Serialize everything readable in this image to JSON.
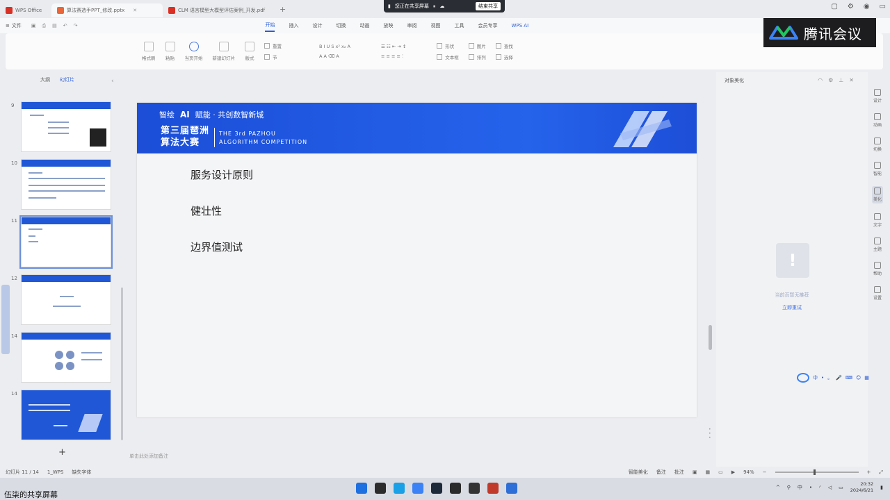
{
  "titlebar": {
    "tabs": [
      {
        "label": "WPS Office",
        "color": "#d93025"
      },
      {
        "label": "算法赛选手PPT_修改.pptx",
        "color": "#e8663a"
      },
      {
        "label": "CLM 语言模型大模型评估案例_开发.pdf",
        "color": "#d93025"
      }
    ],
    "new_tab": "+",
    "share_banner": {
      "label": "您正在共享屏幕",
      "stop": "结束共享"
    }
  },
  "menubar": {
    "file": "文件",
    "items": [
      "开始",
      "插入",
      "设计",
      "切换",
      "动画",
      "放映",
      "审阅",
      "视图",
      "工具",
      "会员专享"
    ],
    "active": "开始",
    "wps_ai": "WPS AI"
  },
  "ribbon": {
    "buttons": [
      "格式刷",
      "粘贴",
      "当页开始",
      "新建幻灯片",
      "版式",
      "节",
      "重置"
    ],
    "right_small": [
      "形状",
      "图片",
      "查找",
      "文本框",
      "排列",
      "选择"
    ]
  },
  "tencent_meeting": {
    "name": "腾讯会议"
  },
  "left_panel": {
    "tabs": [
      "大纲",
      "幻灯片"
    ],
    "active_tab": "幻灯片",
    "thumbnails": [
      {
        "num": "9"
      },
      {
        "num": "10"
      },
      {
        "num": "11"
      },
      {
        "num": "12"
      },
      {
        "num": "14"
      },
      {
        "num": "14"
      }
    ],
    "add": "+"
  },
  "slide": {
    "header_top": {
      "prefix": "智绘",
      "ai": "AI",
      "rest": "赋能 · 共创数智新城"
    },
    "cn_title_line1": "第三届琶洲",
    "cn_title_line2": "算法大赛",
    "en_line1": "THE 3rd PAZHOU",
    "en_line2": "ALGORITHM COMPETITION",
    "bullets": [
      "服务设计原则",
      "健壮性",
      "边界值测试"
    ],
    "brand_color": "#1f55d6"
  },
  "notes": "单击此处添加备注",
  "right_panel": {
    "title": "对象美化",
    "empty_text": "当前页暂无推荐",
    "empty_link": "立即重试"
  },
  "right_rail": [
    "设计",
    "动画",
    "切换",
    "智能",
    "美化",
    "文字",
    "主题",
    "帮助",
    "设置"
  ],
  "ime": {
    "items": [
      "中",
      "•",
      "。",
      "🎤"
    ]
  },
  "statusbar": {
    "slide_pos": "幻灯片 11 / 14",
    "theme": "1_WPS",
    "font": "缺失字体",
    "smart": "智能美化",
    "notes": "备注",
    "comment": "批注",
    "zoom": "94%",
    "zoom_level": 0.47
  },
  "taskbar": {
    "caption": "伍柒的共享屏幕",
    "time": "20:32",
    "date": "2024/6/21",
    "ime": "中",
    "icon_colors": [
      "#1e6fe0",
      "#2c2c2c",
      "#19a0e6",
      "#3b82f6",
      "#1c2a3a",
      "#2b2b2b",
      "#333333",
      "#c0392b",
      "#2d6fd6"
    ]
  }
}
